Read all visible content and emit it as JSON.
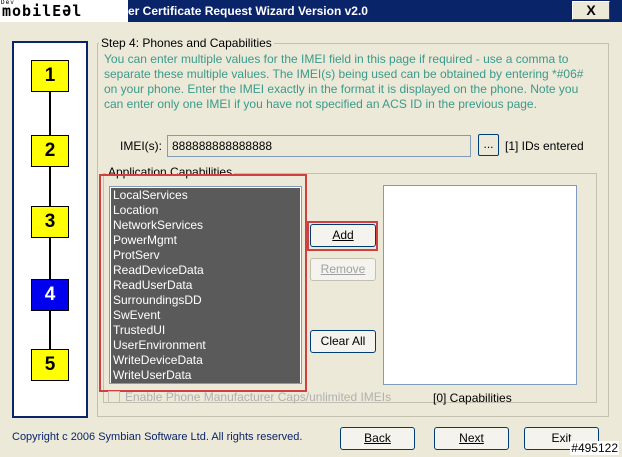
{
  "window": {
    "logo_text": "mobilEƏl",
    "logo_small": "Dev",
    "title": "er Certificate Request Wizard Version v2.0",
    "close_label": "X"
  },
  "steps": [
    {
      "label": "1",
      "active": false
    },
    {
      "label": "2",
      "active": false
    },
    {
      "label": "3",
      "active": false
    },
    {
      "label": "4",
      "active": true
    },
    {
      "label": "5",
      "active": false
    }
  ],
  "step_group": {
    "title": "Step 4: Phones and Capabilities",
    "instructions": "You can enter multiple values for the IMEI field in this page if required - use a comma to separate these multiple values. The IMEI(s) being used can be obtained by entering *#06# on your phone. Enter the IMEI exactly in the format it is displayed on the phone. Note you can enter only one IMEI if you have not specified an ACS ID in the previous page."
  },
  "imei": {
    "label": "IMEI(s):",
    "value": "888888888888888",
    "browse_label": "...",
    "ids_entered": "[1] IDs entered"
  },
  "app_caps": {
    "title": "Application Capabilities",
    "items": [
      "LocalServices",
      "Location",
      "NetworkServices",
      "PowerMgmt",
      "ProtServ",
      "ReadDeviceData",
      "ReadUserData",
      "SurroundingsDD",
      "SwEvent",
      "TrustedUI",
      "UserEnvironment",
      "WriteDeviceData",
      "WriteUserData"
    ],
    "add_label": "Add",
    "remove_label": "Remove",
    "clear_label": "Clear All",
    "count_label": "[0] Capabilities",
    "enable_label": "Enable Phone Manufacturer Caps/unlimited IMEIs"
  },
  "footer": {
    "copyright": "Copyright c 2006 Symbian Software Ltd. All rights reserved.",
    "back_label": "Back",
    "next_label": "Next",
    "exit_label": "Exit",
    "watermark": "#495122"
  },
  "colors": {
    "title_bar": "#0a246a",
    "step_inactive": "#ffff00",
    "step_active": "#0000ee",
    "instructions_text": "#3a9a8c",
    "highlight_frame": "#d04040"
  }
}
